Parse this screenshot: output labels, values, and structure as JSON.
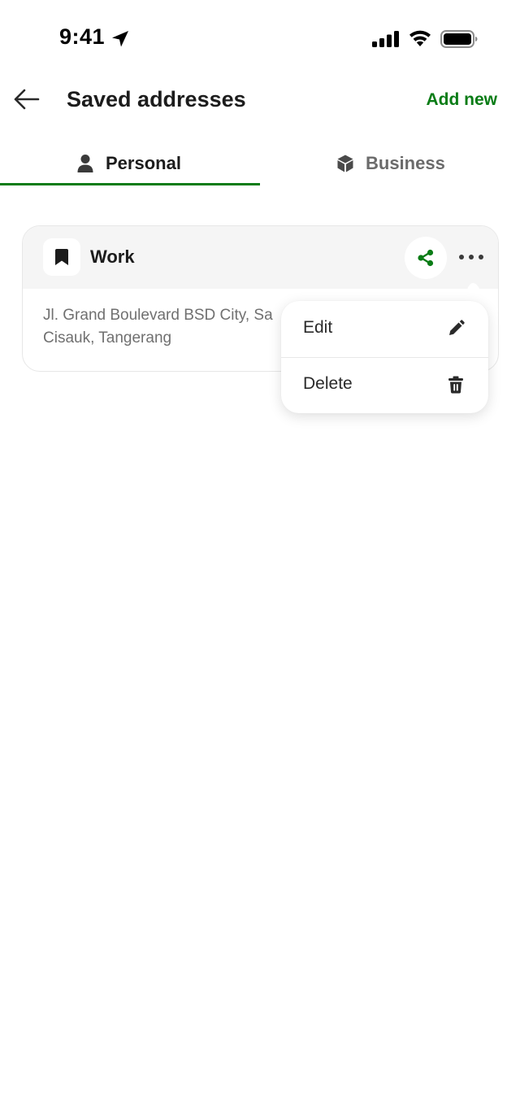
{
  "status_bar": {
    "time": "9:41"
  },
  "header": {
    "title": "Saved addresses",
    "add_new_label": "Add new"
  },
  "tabs": [
    {
      "label": "Personal",
      "icon": "person-icon",
      "active": true
    },
    {
      "label": "Business",
      "icon": "business-cube-icon",
      "active": false
    }
  ],
  "card": {
    "title": "Work",
    "icon": "bookmark-icon",
    "address": "Jl. Grand Boulevard BSD City, Sa\nCisauk, Tangerang",
    "address_line1": "Jl. Grand Boulevard BSD City, Sa",
    "address_line2": "Cisauk, Tangerang"
  },
  "menu": {
    "items": [
      {
        "label": "Edit",
        "icon": "pencil-icon"
      },
      {
        "label": "Delete",
        "icon": "trash-icon"
      }
    ]
  },
  "colors": {
    "accent": "#0a7c16",
    "text_primary": "#1c1c1c",
    "text_secondary": "#707070",
    "card_header_bg": "#f5f5f5"
  }
}
